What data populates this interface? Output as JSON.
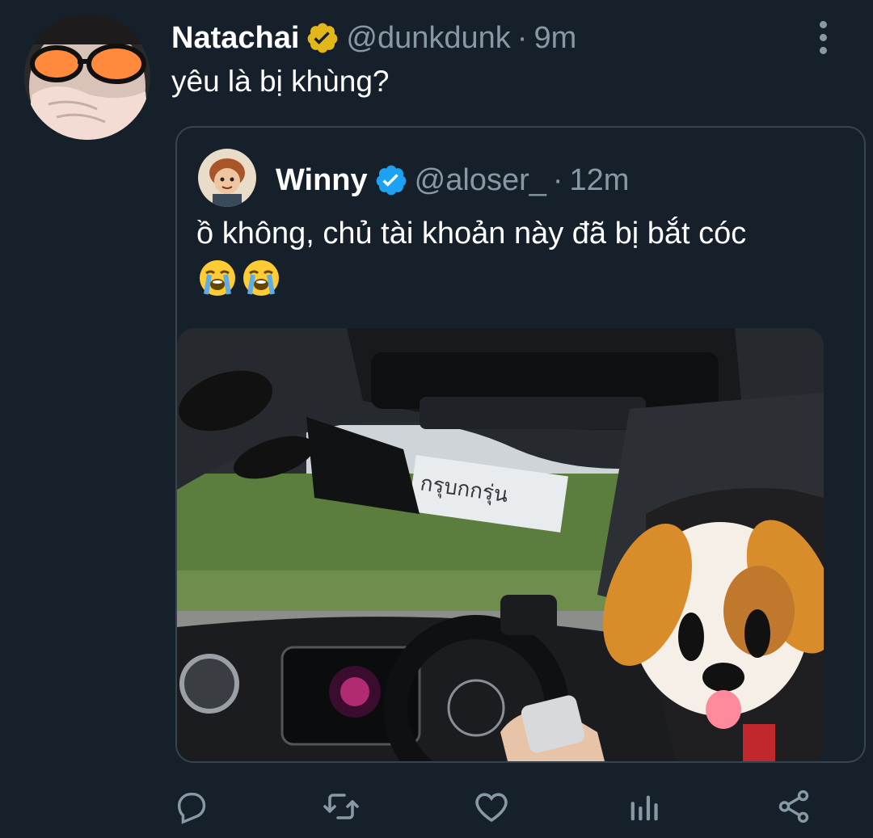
{
  "tweet": {
    "author": {
      "name": "Natachai",
      "handle": "@dunkdunk",
      "time": "9m",
      "verified": true
    },
    "separator": "·",
    "text": "yêu là bị khùng?"
  },
  "quoted": {
    "author": {
      "name": "Winny",
      "handle": "@aloser_",
      "time": "12m",
      "verified": true
    },
    "separator": "·",
    "text": "ồ không, chủ tài khoản này đã bị bắt cóc",
    "emojis": [
      "loudly-crying-face",
      "loudly-crying-face"
    ],
    "media": {
      "description_icon": "car-interior-photo",
      "sign_text": "กรุบกกรุ่น",
      "overlay_emoji": "dog-face"
    }
  },
  "actions": {
    "reply_icon": "reply-icon",
    "retweet_icon": "retweet-icon",
    "like_icon": "like-icon",
    "analytics_icon": "analytics-icon",
    "share_icon": "share-icon"
  },
  "colors": {
    "background": "#15202b",
    "text": "#ffffff",
    "secondary": "#8899a6",
    "border": "#38444d",
    "verified_gold": "#e2b719",
    "verified_blue": "#1da1f2"
  }
}
